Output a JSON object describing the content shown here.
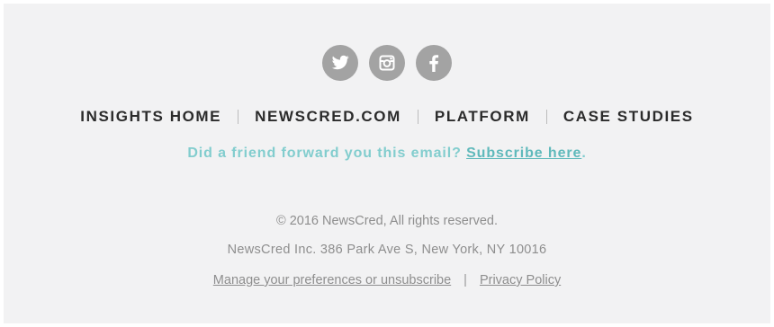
{
  "social": {
    "items": [
      {
        "icon": "twitter-icon",
        "label": "Twitter"
      },
      {
        "icon": "instagram-icon",
        "label": "Instagram"
      },
      {
        "icon": "facebook-icon",
        "label": "Facebook"
      }
    ],
    "circle_color": "#a3a3a3"
  },
  "nav": {
    "insights_home": "INSIGHTS HOME",
    "newscred_com": "NEWSCRED.COM",
    "platform": "PLATFORM",
    "case_studies": "CASE STUDIES"
  },
  "forward": {
    "prompt": "Did a friend forward you this email? ",
    "link": "Subscribe here",
    "suffix": ".",
    "color": "#82cdce"
  },
  "legal": {
    "copyright": "© 2016 NewsCred, All rights reserved.",
    "address": "NewsCred Inc. 386 Park Ave S, New York, NY 10016",
    "manage_link": "Manage your preferences or unsubscribe",
    "separator": "|",
    "privacy_link": "Privacy Policy"
  }
}
